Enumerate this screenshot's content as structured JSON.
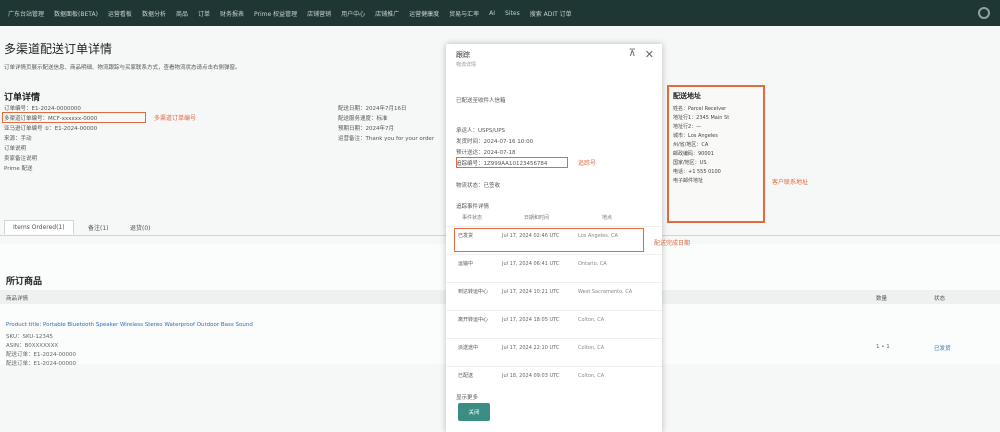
{
  "topnav": {
    "items": [
      "广东台站管理",
      "数据面板(BETA)",
      "运营看板",
      "数据分析",
      "商品",
      "订单",
      "财务报表",
      "Prime 权益管理",
      "店铺营销",
      "用户中心",
      "店铺推广",
      "运营健康度",
      "贸易与汇率",
      "AI",
      "Sites",
      "搜索 ADIT 订单"
    ]
  },
  "page": {
    "title": "多渠道配送订单详情",
    "description": "订单详情页展示配送信息、商品明细、物流跟踪与买家联系方式，查看物流状态请点击右侧弹窗。"
  },
  "order": {
    "section_title": "订单详情",
    "left_lines": [
      "订单编号：E1-2024-0000000",
      "多渠道订单编号：MCF-xxxxxx-0000",
      "亚马逊订单编号 ①：E1-2024-00000",
      "来源：手动",
      "订单说明",
      "卖家备注说明",
      "Prime 配送"
    ],
    "right_lines": [
      "配送日期：2024年7月16日",
      "配送服务速度：标准",
      "预期日期：2024年7月",
      "运营备注：Thank you for your order"
    ],
    "annotation_order_no": "多渠道订单编号"
  },
  "tabs": [
    "Items Ordered(1)",
    "备注(1)",
    "退货(0)"
  ],
  "goods": {
    "section_title": "所订商品",
    "col_product": "商品详情",
    "col_qty": "数量",
    "col_status": "状态",
    "product_line": "Product title: Portable Bluetooth Speaker Wireless Stereo Waterproof Outdoor Bass Sound",
    "sku": "SKU：SKU-12345",
    "asin": "ASIN：B0XXXXXXX",
    "fnsku": "配送订单：E1-2024-00000",
    "shipment": "配送订单：E1-2024-00000",
    "qty": "1 • 1",
    "status": "已发货"
  },
  "contact": {
    "title": "配送地址",
    "lines": [
      "姓名：Parcel Receiver",
      "地址行1：2345 Main St",
      "地址行2：—",
      "城市：Los Angeles",
      "州/省/地区：CA",
      "邮政编码：90001",
      "国家/地区：US",
      "电话：+1 555 0100",
      "电子邮件地址"
    ],
    "annotation": "客户联系地址"
  },
  "modal": {
    "title": "跟踪",
    "subtitle": "物流详情",
    "heading": "已配送至收件人信箱",
    "lines": [
      "承运人：USPS/UPS",
      "发货时间：2024-07-16 10:00",
      "预计送达：2024-07-18",
      "追踪编号：1Z999AA10123456784",
      "物流状态：已签收"
    ],
    "annotation_tracking": "追踪号",
    "table_title": "追踪事件详情",
    "th_status": "事件状态",
    "th_time": "日期和时间",
    "th_location": "地点",
    "rows": [
      {
        "status": "已发货",
        "time": "Jul 17, 2024 02:46 UTC",
        "location": "Los Angeles, CA"
      },
      {
        "status": "运输中",
        "time": "Jul 17, 2024 06:41 UTC",
        "location": "Ontario, CA"
      },
      {
        "status": "到达转运中心",
        "time": "Jul 17, 2024 10:21 UTC",
        "location": "West Sacramento, CA"
      },
      {
        "status": "离开转运中心",
        "time": "Jul 17, 2024 18:05 UTC",
        "location": "Colton, CA"
      },
      {
        "status": "派送途中",
        "time": "Jul 17, 2024 22:10 UTC",
        "location": "Colton, CA"
      },
      {
        "status": "已配送",
        "time": "Jul 18, 2024 09:03 UTC",
        "location": "Colton, CA"
      }
    ],
    "annotation_event": "配送完成日期",
    "footer_note": "显示更多",
    "button": "关闭"
  }
}
